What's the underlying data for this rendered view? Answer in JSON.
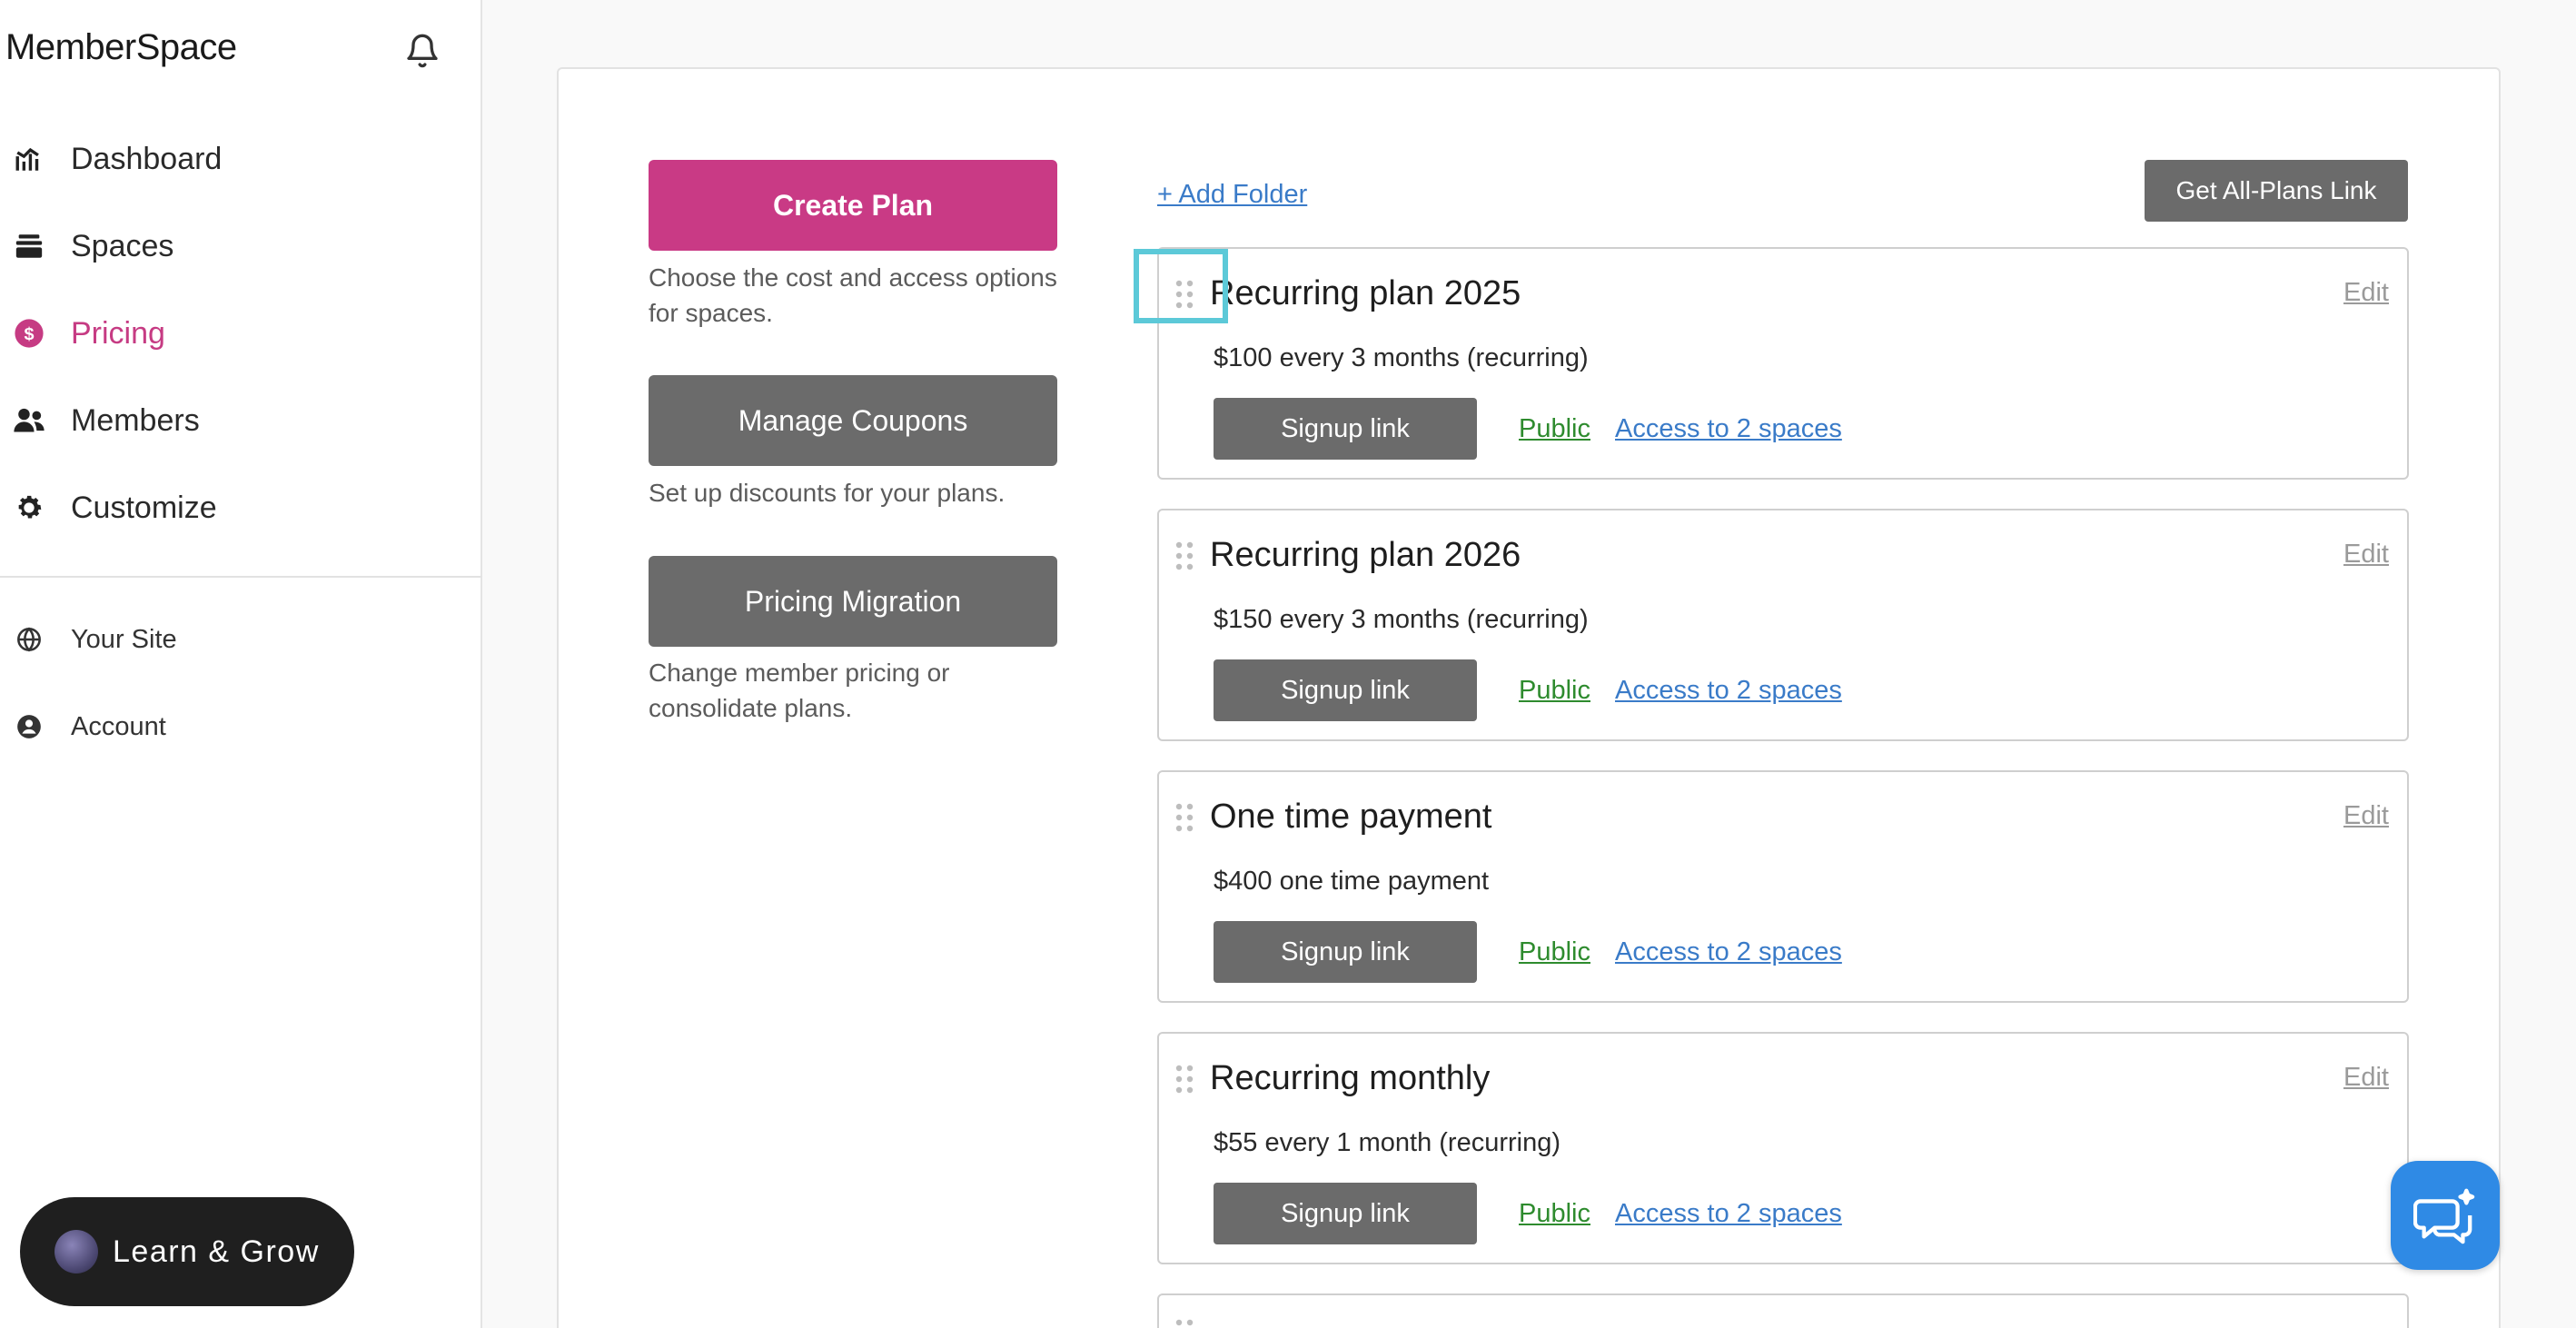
{
  "brand": {
    "name": "MemberSpace"
  },
  "nav": {
    "items": [
      {
        "label": "Dashboard",
        "icon": "chart-icon"
      },
      {
        "label": "Spaces",
        "icon": "layers-icon"
      },
      {
        "label": "Pricing",
        "icon": "dollar-icon",
        "active": true
      },
      {
        "label": "Members",
        "icon": "users-icon"
      },
      {
        "label": "Customize",
        "icon": "gear-icon"
      }
    ],
    "secondary": [
      {
        "label": "Your Site",
        "icon": "globe-icon"
      },
      {
        "label": "Account",
        "icon": "user-circle-icon"
      }
    ]
  },
  "learn": {
    "label": "Learn & Grow"
  },
  "actions": {
    "create_plan": {
      "label": "Create Plan",
      "desc": "Choose the cost and access options for spaces."
    },
    "manage_coupons": {
      "label": "Manage Coupons",
      "desc": "Set up discounts for your plans."
    },
    "pricing_migration": {
      "label": "Pricing Migration",
      "desc": "Change member pricing or consolidate plans."
    }
  },
  "toolbar": {
    "add_folder": "+ Add Folder",
    "all_plans": "Get All-Plans Link"
  },
  "plans": [
    {
      "name": "Recurring plan 2025",
      "price": "$100 every 3 months (recurring)",
      "signup": "Signup link",
      "visibility": "Public",
      "access": "Access to 2 spaces",
      "edit": "Edit"
    },
    {
      "name": "Recurring plan 2026",
      "price": "$150 every 3 months (recurring)",
      "signup": "Signup link",
      "visibility": "Public",
      "access": "Access to 2 spaces",
      "edit": "Edit"
    },
    {
      "name": "One time payment",
      "price": "$400 one time payment",
      "signup": "Signup link",
      "visibility": "Public",
      "access": "Access to 2 spaces",
      "edit": "Edit"
    },
    {
      "name": "Recurring monthly",
      "price": "$55 every 1 month (recurring)",
      "signup": "Signup link",
      "visibility": "Public",
      "access": "Access to 2 spaces",
      "edit": "Edit"
    }
  ],
  "colors": {
    "accent": "#c93a85",
    "link": "#3a7bc8",
    "public": "#2e8b2e",
    "button_gray": "#6b6b6b",
    "chat": "#2f8ae5",
    "focus": "#5cc9d8"
  }
}
